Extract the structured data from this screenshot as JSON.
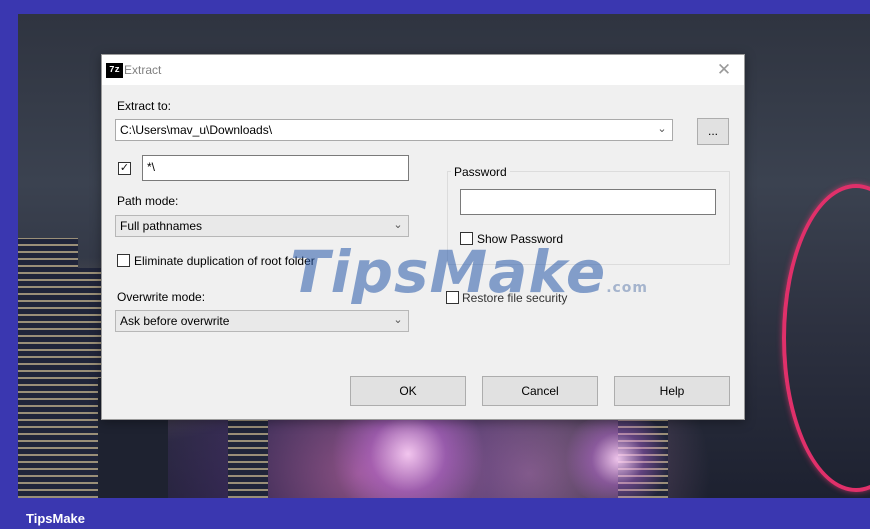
{
  "dialog": {
    "title": "Extract",
    "app_icon_text": "7z",
    "close_symbol": "✕",
    "extract_to_label": "Extract to:",
    "extract_to_value": "C:\\Users\\mav_u\\Downloads\\",
    "browse_label": "...",
    "subfolder_checked": true,
    "subfolder_value": "*\\",
    "path_mode_label": "Path mode:",
    "path_mode_value": "Full pathnames",
    "eliminate_dup_label": "Eliminate duplication of root folder",
    "eliminate_dup_checked": false,
    "overwrite_mode_label": "Overwrite mode:",
    "overwrite_mode_value": "Ask before overwrite",
    "password_group_label": "Password",
    "password_value": "",
    "show_password_label": "Show Password",
    "show_password_checked": false,
    "restore_security_label": "Restore file security",
    "restore_security_checked": false,
    "ok_label": "OK",
    "cancel_label": "Cancel",
    "help_label": "Help"
  },
  "watermark": {
    "text": "TipsMake",
    "suffix": ".com"
  },
  "brand": "TipsMake",
  "colors": {
    "frame": "#3a37b0",
    "dialog_bg": "#f0f0f0",
    "button_bg": "#e1e1e1"
  }
}
